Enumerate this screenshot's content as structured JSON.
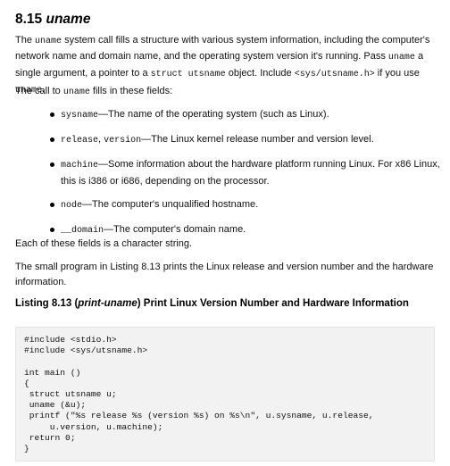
{
  "section": {
    "number": "8.15",
    "command": "uname"
  },
  "intro": {
    "t1": "The ",
    "c1": "uname",
    "t2": " system call fills a structure with various system information, including the computer's network name and domain name, and the operating system version it's running. Pass ",
    "c2": "uname",
    "t3": " a single argument, a pointer to a ",
    "c3": "struct utsname",
    "t4": " object. Include ",
    "c4": "<sys/utsname.h>",
    "t5": " if you use ",
    "c5": "uname",
    "t6": "."
  },
  "fields_intro": {
    "t1": "The call to ",
    "c1": "uname",
    "t2": " fills in these fields:"
  },
  "fields": [
    {
      "code": "sysname",
      "text": "—The name of the operating system (such as Linux)."
    },
    {
      "code": "release",
      "sep": ", ",
      "code2": "version",
      "text": "—The Linux kernel release number and version level."
    },
    {
      "code": "machine",
      "text": "—Some information about the hardware platform running Linux. For x86 Linux, this is i386 or i686, depending on the processor."
    },
    {
      "code": "node",
      "text": "—The computer's unqualified hostname."
    },
    {
      "code": "__domain",
      "text": "—The computer's domain name."
    }
  ],
  "each_field": "Each of these fields is a character string.",
  "small_program": "The small program in Listing 8.13 prints the Linux release and version number and the hardware information.",
  "listing": {
    "label": "Listing 8.13 (",
    "file": "print-uname",
    "title": ") Print Linux Version Number and Hardware Information"
  },
  "code": "#include <stdio.h>\n#include <sys/utsname.h>\n\nint main ()\n{\n struct utsname u;\n uname (&u);\n printf (\"%s release %s (version %s) on %s\\n\", u.sysname, u.release,\n     u.version, u.machine);\n return 0;\n}"
}
